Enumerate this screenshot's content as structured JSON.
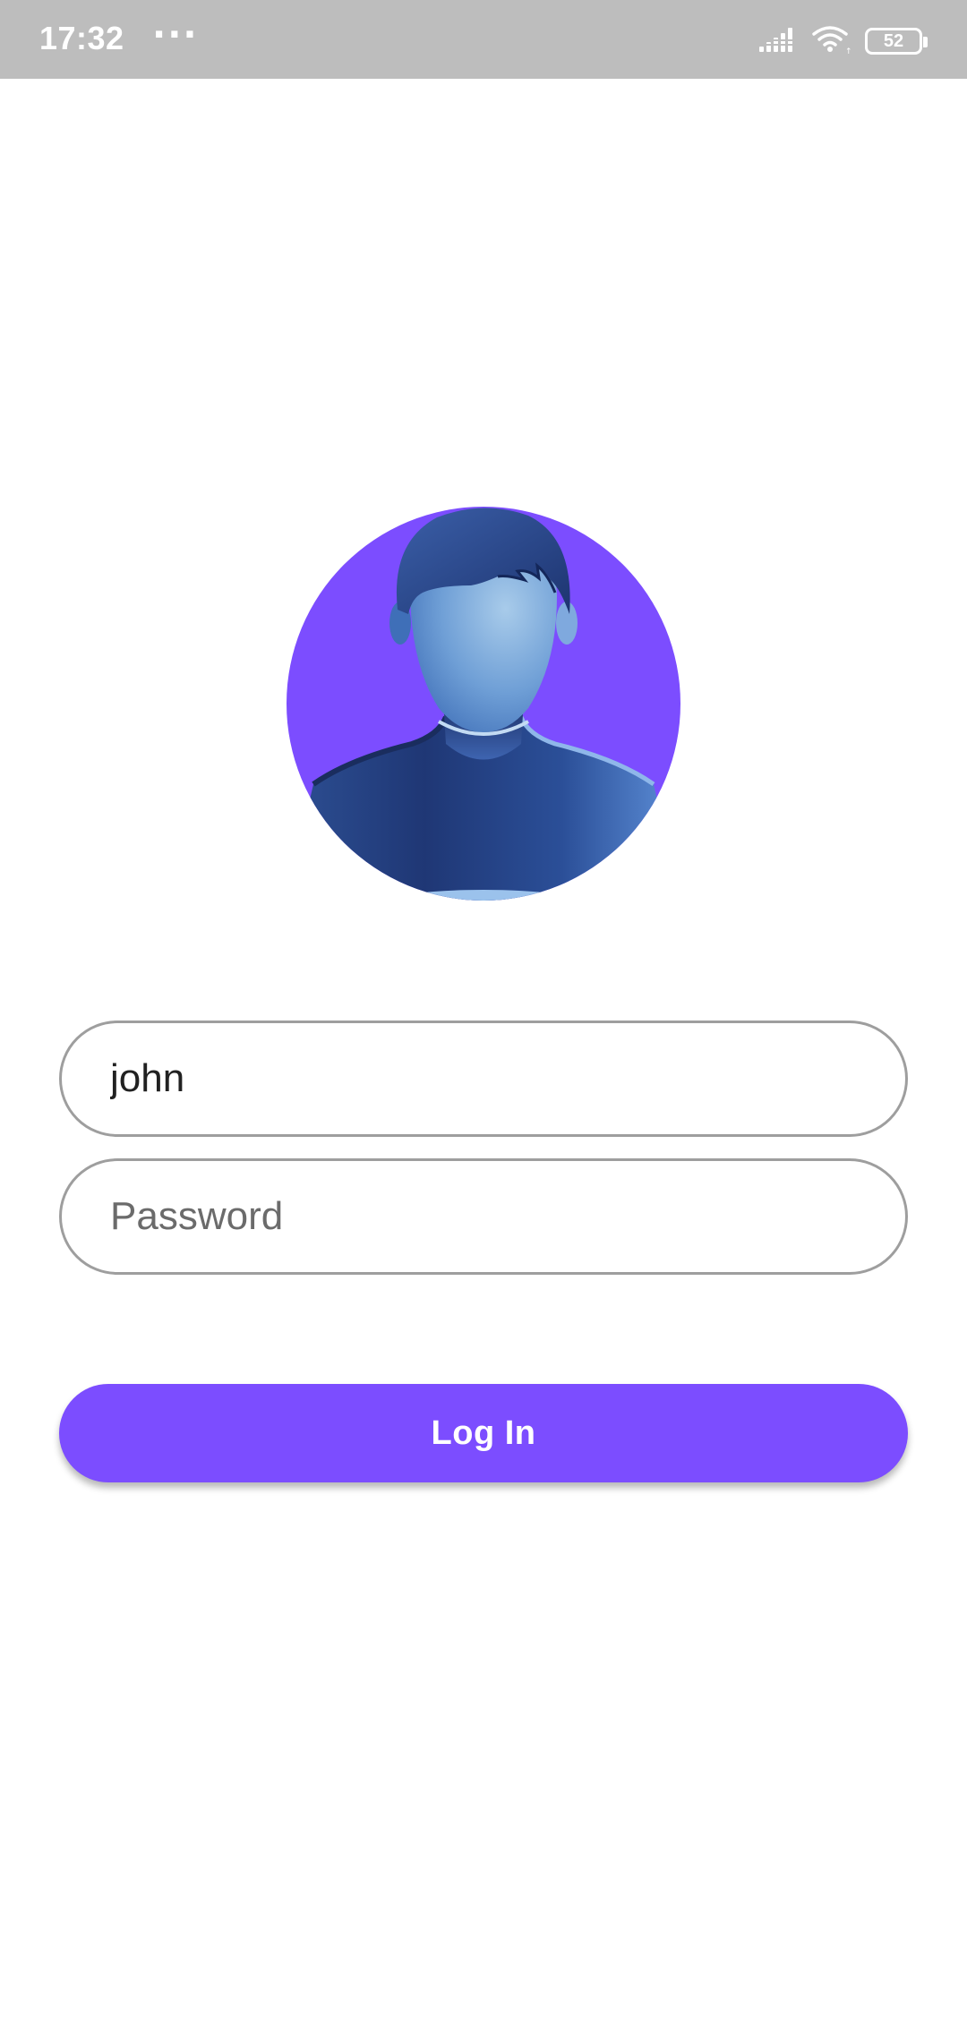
{
  "status_bar": {
    "time": "17:32",
    "more_indicator": "···",
    "icons": [
      "signal-icon",
      "wifi-icon",
      "battery-icon"
    ],
    "battery_level": "52"
  },
  "avatar": {
    "icon": "user-avatar-icon",
    "background_color": "#7c4dff"
  },
  "login_form": {
    "username": {
      "value": "john",
      "placeholder": ""
    },
    "password": {
      "value": "",
      "placeholder": "Password"
    },
    "submit_label": "Log In"
  },
  "colors": {
    "accent": "#7c4dff",
    "status_bar_bg": "#bdbdbd",
    "input_border": "#9e9e9e"
  }
}
